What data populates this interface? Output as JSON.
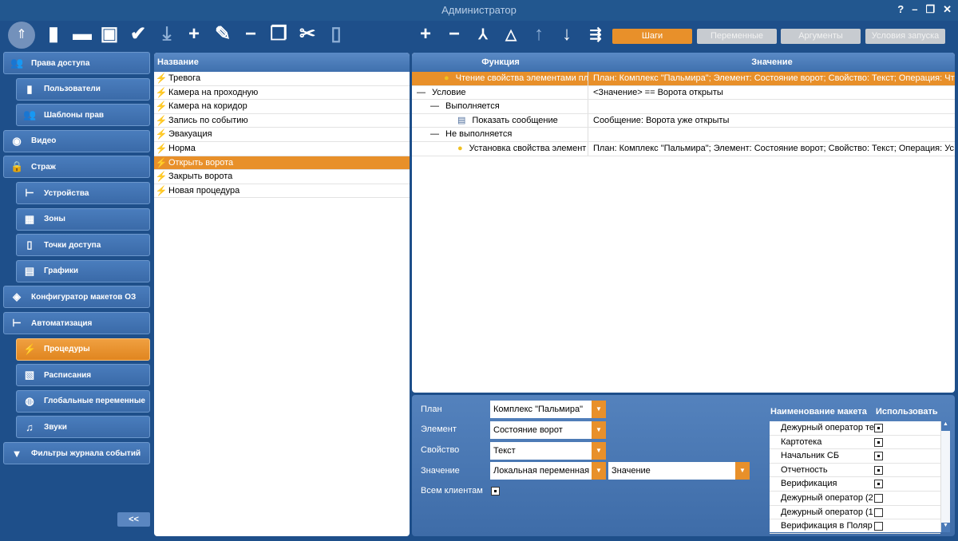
{
  "window": {
    "title": "Администратор",
    "help": "?",
    "minimize": "–",
    "restore": "❐",
    "close": "✕"
  },
  "toolbar": {
    "tabs": [
      {
        "label": "Шаги",
        "active": true
      },
      {
        "label": "Переменные",
        "active": false
      },
      {
        "label": "Аргументы",
        "active": false
      },
      {
        "label": "Условия запуска",
        "active": false
      }
    ]
  },
  "sidebar": {
    "items": [
      {
        "label": "Права доступа",
        "icon": "users-icon",
        "sub": false
      },
      {
        "label": "Пользователи",
        "icon": "user-icon",
        "sub": true
      },
      {
        "label": "Шаблоны прав",
        "icon": "users-icon",
        "sub": true
      },
      {
        "label": "Видео",
        "icon": "camera-icon",
        "sub": false
      },
      {
        "label": "Страж",
        "icon": "lock-icon",
        "sub": false
      },
      {
        "label": "Устройства",
        "icon": "tree-icon",
        "sub": true
      },
      {
        "label": "Зоны",
        "icon": "grid-icon",
        "sub": true
      },
      {
        "label": "Точки доступа",
        "icon": "door-icon",
        "sub": true
      },
      {
        "label": "Графики",
        "icon": "schedule-icon",
        "sub": true
      },
      {
        "label": "Конфигуратор макетов ОЗ",
        "icon": "layers-icon",
        "sub": false
      },
      {
        "label": "Автоматизация",
        "icon": "tree-icon",
        "sub": false
      },
      {
        "label": "Процедуры",
        "icon": "bolt-icon",
        "sub": true,
        "active": true
      },
      {
        "label": "Расписания",
        "icon": "calendar-icon",
        "sub": true
      },
      {
        "label": "Глобальные переменные",
        "icon": "globe-icon",
        "sub": true
      },
      {
        "label": "Звуки",
        "icon": "music-icon",
        "sub": true
      },
      {
        "label": "Фильтры журнала событий",
        "icon": "filter-icon",
        "sub": false
      }
    ],
    "collapse": "<<"
  },
  "procedures": {
    "header": "Название",
    "items": [
      "Тревога",
      "Камера на проходную",
      "Камера на коридор",
      "Запись по событию",
      "Эвакуация",
      "Норма",
      "Открыть ворота",
      "Закрыть ворота",
      "Новая процедура"
    ],
    "selected": 6
  },
  "steps": {
    "headers": [
      "Функция",
      "Значение"
    ],
    "rows": [
      {
        "func": "Чтение свойства элементами план",
        "value": "План: Комплекс \"Пальмира\"; Элемент: Состояние ворот; Свойство: Текст; Операция: Чт",
        "indent": 2,
        "icon": "pin-icon",
        "selected": true
      },
      {
        "func": "Условие",
        "value": "<Значение> == Ворота открыты",
        "indent": 0,
        "icon": "collapse-icon"
      },
      {
        "func": "Выполняется",
        "value": "",
        "indent": 1,
        "icon": "collapse-icon"
      },
      {
        "func": "Показать сообщение",
        "value": "Сообщение: Ворота уже открыты",
        "indent": 3,
        "icon": "message-icon"
      },
      {
        "func": "Не выполняется",
        "value": "",
        "indent": 1,
        "icon": "collapse-icon"
      },
      {
        "func": "Установка свойства элемент",
        "value": "План: Комплекс \"Пальмира\"; Элемент: Состояние ворот; Свойство: Текст; Операция: Ус",
        "indent": 3,
        "icon": "pin-icon"
      }
    ]
  },
  "props": {
    "plan_label": "План",
    "plan": "Комплекс \"Пальмира\"",
    "element_label": "Элемент",
    "element": "Состояние ворот",
    "property_label": "Свойство",
    "property": "Текст",
    "value_label": "Значение",
    "value_type": "Локальная переменная",
    "value": "Значение",
    "all_clients_label": "Всем клиентам",
    "all_clients": true
  },
  "layouts": {
    "headers": [
      "Наименование макета",
      "Использовать"
    ],
    "rows": [
      {
        "name": "Дежурный оператор те",
        "use": true
      },
      {
        "name": "Картотека",
        "use": true
      },
      {
        "name": "Начальник СБ",
        "use": true
      },
      {
        "name": "Отчетность",
        "use": true
      },
      {
        "name": "Верификация",
        "use": true
      },
      {
        "name": "Дежурный оператор (2",
        "use": false
      },
      {
        "name": "Дежурный оператор (1",
        "use": false
      },
      {
        "name": "Верификация в Поляр",
        "use": false
      }
    ]
  }
}
